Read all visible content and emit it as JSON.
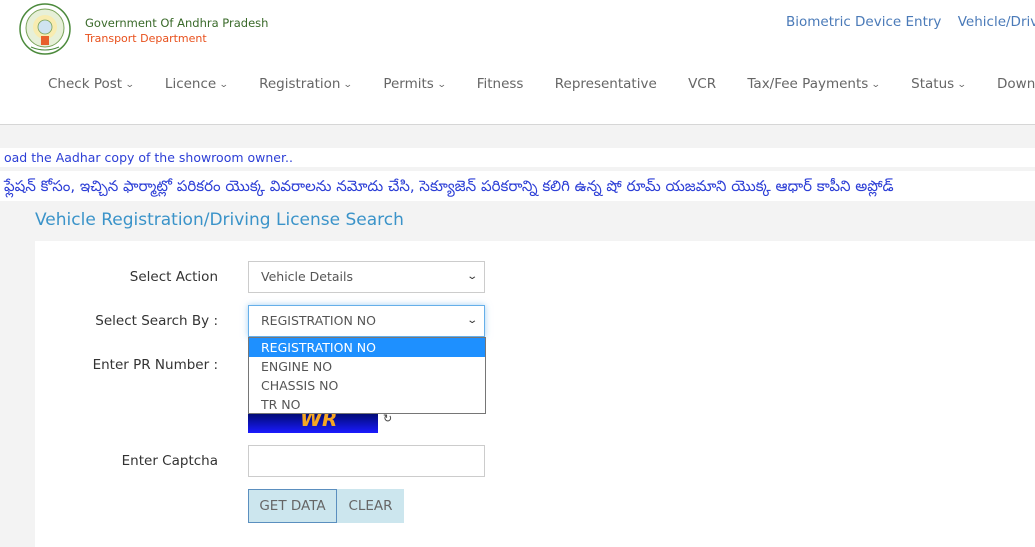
{
  "header": {
    "brand_line1": "Government Of Andhra Pradesh",
    "brand_line2": "Transport Department",
    "top_links": [
      "Biometric Device Entry",
      "Vehicle/Drivin"
    ]
  },
  "nav": {
    "items": [
      {
        "label": "Check Post",
        "has_dropdown": true
      },
      {
        "label": "Licence",
        "has_dropdown": true
      },
      {
        "label": "Registration",
        "has_dropdown": true
      },
      {
        "label": "Permits",
        "has_dropdown": true
      },
      {
        "label": "Fitness",
        "has_dropdown": false
      },
      {
        "label": "Representative",
        "has_dropdown": false
      },
      {
        "label": "VCR",
        "has_dropdown": false
      },
      {
        "label": "Tax/Fee Payments",
        "has_dropdown": true
      },
      {
        "label": "Status",
        "has_dropdown": true
      },
      {
        "label": "Download",
        "has_dropdown": false
      }
    ],
    "chevron": "⌄"
  },
  "marquee": {
    "english": "oad the Aadhar copy of the showroom owner..",
    "telugu": "ఫ్లేషన్ కోసం, ఇచ్చిన ఫార్మాట్లో పరికరం యొక్క వివరాలను నమోదు చేసి, సెక్యూజెన్ పరికరాన్ని కలిగి ఉన్న షో రూమ్ యజమాని యొక్క ఆధార్ కాపీని అప్లోడ్"
  },
  "page": {
    "title": "Vehicle Registration/Driving License Search"
  },
  "form": {
    "select_action": {
      "label": "Select Action",
      "value": "Vehicle Details"
    },
    "select_search_by": {
      "label": "Select Search By :",
      "value": "REGISTRATION NO",
      "options": [
        "REGISTRATION NO",
        "ENGINE NO",
        "CHASSIS NO",
        "TR NO"
      ],
      "highlighted": "REGISTRATION NO"
    },
    "pr_number": {
      "label": "Enter PR Number :"
    },
    "captcha_image_text": "WR",
    "captcha": {
      "label": "Enter Captcha",
      "value": ""
    },
    "buttons": {
      "get_data": "GET DATA",
      "clear": "CLEAR"
    }
  },
  "colors": {
    "link_blue": "#4a7ab8",
    "title_blue": "#3a93c9",
    "marquee_blue": "#2c3ed6",
    "option_highlight": "#1e90ff",
    "button_bg": "#cce6ee",
    "brand_green": "#3a6a2a",
    "brand_orange": "#e8501c"
  }
}
